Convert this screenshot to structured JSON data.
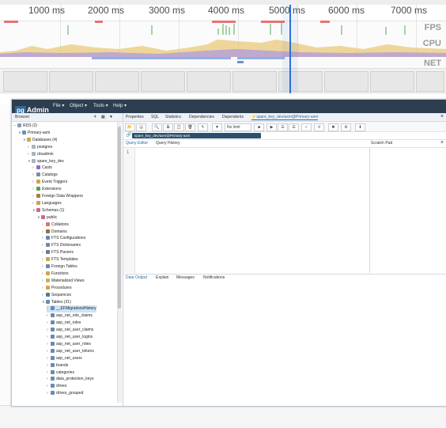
{
  "devtools": {
    "ticks": [
      "1000 ms",
      "2000 ms",
      "3000 ms",
      "4000 ms",
      "5000 ms",
      "6000 ms",
      "7000 ms"
    ],
    "lanes": {
      "fps": "FPS",
      "cpu": "CPU",
      "net": "NET"
    },
    "colors": {
      "fps_green": "#4caf50",
      "cpu_yellow": "#e9c97a",
      "cpu_purple": "#b39ddb",
      "net_blue": "#8fb0e8",
      "cursor": "#2f6fd6",
      "red_mark": "#e57373"
    }
  },
  "pgadmin": {
    "logo": {
      "pg": "pg",
      "admin": "Admin"
    },
    "menu": [
      "File ▾",
      "Object ▾",
      "Tools ▾",
      "Help ▾"
    ],
    "browser": {
      "title": "Browser",
      "tree": [
        {
          "label": "RDS (2)",
          "indent": 0,
          "twisty": "−",
          "icon": "#8a9bb0"
        },
        {
          "label": "Primary-axm",
          "indent": 1,
          "twisty": "∨",
          "icon": "#6d8fb5"
        },
        {
          "label": "Databases (4)",
          "indent": 2,
          "twisty": "∨",
          "icon": "#c9a64a"
        },
        {
          "label": "postgres",
          "indent": 3,
          "twisty": "›",
          "icon": "#a8b3bd"
        },
        {
          "label": "rdsadmin",
          "indent": 3,
          "twisty": "›",
          "icon": "#a8b3bd"
        },
        {
          "label": "spare_key_dev",
          "indent": 3,
          "twisty": "∨",
          "icon": "#a8b3bd"
        },
        {
          "label": "Casts",
          "indent": 4,
          "twisty": "›",
          "icon": "#8b6ccf"
        },
        {
          "label": "Catalogs",
          "indent": 4,
          "twisty": "›",
          "icon": "#7a8fa6"
        },
        {
          "label": "Event Triggers",
          "indent": 4,
          "twisty": "›",
          "icon": "#d4a34a"
        },
        {
          "label": "Extensions",
          "indent": 4,
          "twisty": "›",
          "icon": "#5a9e5a"
        },
        {
          "label": "Foreign Data Wrappers",
          "indent": 4,
          "twisty": "›",
          "icon": "#b07a3a"
        },
        {
          "label": "Languages",
          "indent": 4,
          "twisty": "›",
          "icon": "#c9a64a"
        },
        {
          "label": "Schemas (1)",
          "indent": 4,
          "twisty": "∨",
          "icon": "#c96a8a"
        },
        {
          "label": "public",
          "indent": 5,
          "twisty": "∨",
          "icon": "#c96a8a"
        },
        {
          "label": "Collations",
          "indent": 6,
          "twisty": "›",
          "icon": "#d77a5a"
        },
        {
          "label": "Domains",
          "indent": 6,
          "twisty": "›",
          "icon": "#9a6a4a"
        },
        {
          "label": "FTS Configurations",
          "indent": 6,
          "twisty": "›",
          "icon": "#6a8ab0"
        },
        {
          "label": "FTS Dictionaries",
          "indent": 6,
          "twisty": "›",
          "icon": "#6a8ab0"
        },
        {
          "label": "FTS Parsers",
          "indent": 6,
          "twisty": "›",
          "icon": "#7a7a7a"
        },
        {
          "label": "FTS Templates",
          "indent": 6,
          "twisty": "›",
          "icon": "#d4a34a"
        },
        {
          "label": "Foreign Tables",
          "indent": 6,
          "twisty": "›",
          "icon": "#6a8ab0"
        },
        {
          "label": "Functions",
          "indent": 6,
          "twisty": "›",
          "icon": "#d4a34a"
        },
        {
          "label": "Materialized Views",
          "indent": 6,
          "twisty": "›",
          "icon": "#c9b24a"
        },
        {
          "label": "Procedures",
          "indent": 6,
          "twisty": "›",
          "icon": "#d4a34a"
        },
        {
          "label": "Sequences",
          "indent": 6,
          "twisty": "›",
          "icon": "#5a7a9a"
        },
        {
          "label": "Tables (31)",
          "indent": 6,
          "twisty": "∨",
          "icon": "#6a8ab0"
        },
        {
          "label": "__EFMigrationsHistory",
          "indent": 7,
          "twisty": "›",
          "icon": "#6a8ab0",
          "selected": true
        },
        {
          "label": "asp_net_role_claims",
          "indent": 7,
          "twisty": "›",
          "icon": "#6a8ab0"
        },
        {
          "label": "asp_net_roles",
          "indent": 7,
          "twisty": "›",
          "icon": "#6a8ab0"
        },
        {
          "label": "asp_net_user_claims",
          "indent": 7,
          "twisty": "›",
          "icon": "#6a8ab0"
        },
        {
          "label": "asp_net_user_logins",
          "indent": 7,
          "twisty": "›",
          "icon": "#6a8ab0"
        },
        {
          "label": "asp_net_user_roles",
          "indent": 7,
          "twisty": "›",
          "icon": "#6a8ab0"
        },
        {
          "label": "asp_net_user_tokens",
          "indent": 7,
          "twisty": "›",
          "icon": "#6a8ab0"
        },
        {
          "label": "asp_net_users",
          "indent": 7,
          "twisty": "›",
          "icon": "#6a8ab0"
        },
        {
          "label": "brands",
          "indent": 7,
          "twisty": "›",
          "icon": "#6a8ab0"
        },
        {
          "label": "categories",
          "indent": 7,
          "twisty": "›",
          "icon": "#6a8ab0"
        },
        {
          "label": "data_protection_keys",
          "indent": 7,
          "twisty": "›",
          "icon": "#6a8ab0"
        },
        {
          "label": "drives",
          "indent": 7,
          "twisty": "›",
          "icon": "#6a8ab0"
        },
        {
          "label": "drives_grouped",
          "indent": 7,
          "twisty": "›",
          "icon": "#6a8ab0"
        }
      ]
    },
    "tabs": [
      "Properties",
      "SQL",
      "Statistics",
      "Dependencies",
      "Dependents",
      "⚡spare_key_dev/axm@Primary-axm"
    ],
    "connection": "spare_key_dev/axm@Primary-axm",
    "no_limit": "No limit",
    "editor_tabs": [
      "Query Editor",
      "Query History"
    ],
    "scratch_pad": "Scratch Pad",
    "line_number": "1",
    "output_tabs": [
      "Data Output",
      "Explain",
      "Messages",
      "Notifications"
    ]
  }
}
